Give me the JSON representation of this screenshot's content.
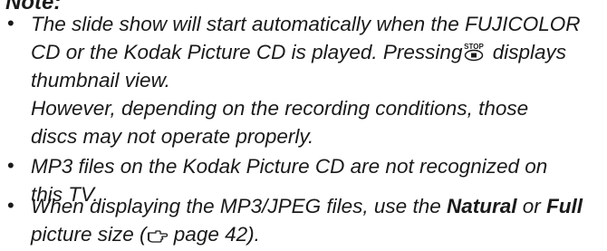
{
  "heading": "Note:",
  "bullet_glyph": "•",
  "notes": [
    {
      "line1_before_icon": "The slide show will start automatically when the FUJICOLOR",
      "line2_before_icon": "CD or the Kodak Picture CD is played. Pressing",
      "stop_icon_label": "STOP",
      "line2_after_icon": " displays",
      "line3": "thumbnail view.",
      "line4": "However, depending on the recording conditions, those",
      "line5": "discs may not operate properly."
    },
    {
      "line1": "MP3 files on the Kodak Picture CD are not recognized on",
      "line2": "this TV."
    },
    {
      "line1_before_natural": "When displaying the MP3/JPEG files, use the ",
      "natural": "Natural",
      "or": " or ",
      "full": "Full",
      "line2_before_ref": "picture size (",
      "ref_icon": "pointing-hand-icon",
      "line2_after_ref": " page 42)."
    }
  ]
}
